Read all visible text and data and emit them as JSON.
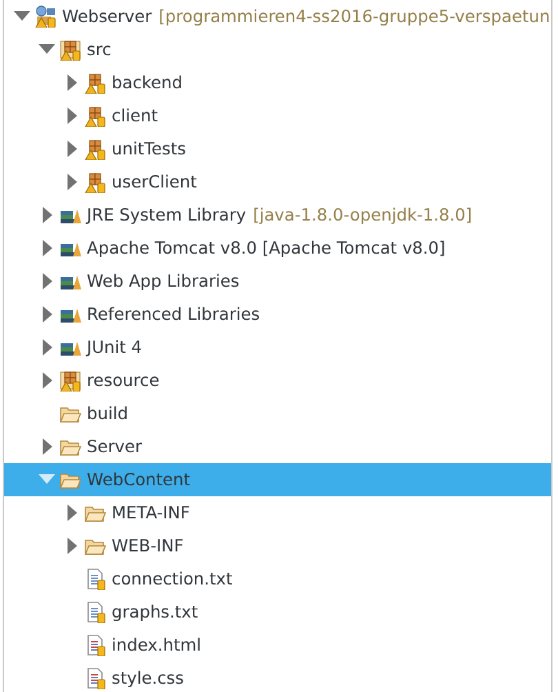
{
  "tree": [
    {
      "label": "Webserver",
      "decoration": "[programmieren4-ss2016-gruppe5-verspaetun",
      "kind": "project",
      "expanded": true,
      "selected": false,
      "children": [
        {
          "label": "src",
          "kind": "source-folder",
          "expanded": true,
          "selected": false,
          "children": [
            {
              "label": "backend",
              "kind": "package",
              "expanded": false,
              "selected": false
            },
            {
              "label": "client",
              "kind": "package",
              "expanded": false,
              "selected": false
            },
            {
              "label": "unitTests",
              "kind": "package",
              "expanded": false,
              "selected": false
            },
            {
              "label": "userClient",
              "kind": "package",
              "expanded": false,
              "selected": false
            }
          ]
        },
        {
          "label": "JRE System Library",
          "decoration": "[java-1.8.0-openjdk-1.8.0]",
          "kind": "library",
          "expanded": false,
          "selected": false
        },
        {
          "label": "Apache Tomcat v8.0 [Apache Tomcat v8.0]",
          "kind": "library",
          "expanded": false,
          "selected": false
        },
        {
          "label": "Web App Libraries",
          "kind": "library",
          "expanded": false,
          "selected": false
        },
        {
          "label": "Referenced Libraries",
          "kind": "library",
          "expanded": false,
          "selected": false
        },
        {
          "label": "JUnit 4",
          "kind": "library",
          "expanded": false,
          "selected": false
        },
        {
          "label": "resource",
          "kind": "source-folder",
          "expanded": false,
          "selected": false
        },
        {
          "label": "build",
          "kind": "folder",
          "selected": false
        },
        {
          "label": "Server",
          "kind": "folder",
          "expanded": false,
          "selected": false
        },
        {
          "label": "WebContent",
          "kind": "folder",
          "expanded": true,
          "selected": true,
          "children": [
            {
              "label": "META-INF",
              "kind": "folder",
              "expanded": false,
              "selected": false
            },
            {
              "label": "WEB-INF",
              "kind": "folder",
              "expanded": false,
              "selected": false
            },
            {
              "label": "connection.txt",
              "kind": "text-file",
              "selected": false
            },
            {
              "label": "graphs.txt",
              "kind": "text-file",
              "selected": false
            },
            {
              "label": "index.html",
              "kind": "web-file",
              "selected": false
            },
            {
              "label": "style.css",
              "kind": "web-file",
              "selected": false
            }
          ]
        }
      ]
    }
  ]
}
